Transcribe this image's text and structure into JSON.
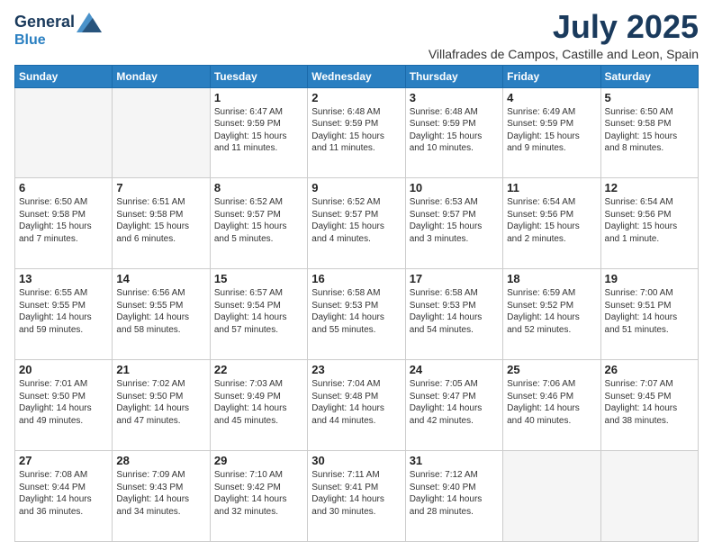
{
  "logo": {
    "line1": "General",
    "line2": "Blue"
  },
  "title": "July 2025",
  "location": "Villafrades de Campos, Castille and Leon, Spain",
  "weekdays": [
    "Sunday",
    "Monday",
    "Tuesday",
    "Wednesday",
    "Thursday",
    "Friday",
    "Saturday"
  ],
  "weeks": [
    [
      {
        "day": "",
        "info": ""
      },
      {
        "day": "",
        "info": ""
      },
      {
        "day": "1",
        "info": "Sunrise: 6:47 AM\nSunset: 9:59 PM\nDaylight: 15 hours and 11 minutes."
      },
      {
        "day": "2",
        "info": "Sunrise: 6:48 AM\nSunset: 9:59 PM\nDaylight: 15 hours and 11 minutes."
      },
      {
        "day": "3",
        "info": "Sunrise: 6:48 AM\nSunset: 9:59 PM\nDaylight: 15 hours and 10 minutes."
      },
      {
        "day": "4",
        "info": "Sunrise: 6:49 AM\nSunset: 9:59 PM\nDaylight: 15 hours and 9 minutes."
      },
      {
        "day": "5",
        "info": "Sunrise: 6:50 AM\nSunset: 9:58 PM\nDaylight: 15 hours and 8 minutes."
      }
    ],
    [
      {
        "day": "6",
        "info": "Sunrise: 6:50 AM\nSunset: 9:58 PM\nDaylight: 15 hours and 7 minutes."
      },
      {
        "day": "7",
        "info": "Sunrise: 6:51 AM\nSunset: 9:58 PM\nDaylight: 15 hours and 6 minutes."
      },
      {
        "day": "8",
        "info": "Sunrise: 6:52 AM\nSunset: 9:57 PM\nDaylight: 15 hours and 5 minutes."
      },
      {
        "day": "9",
        "info": "Sunrise: 6:52 AM\nSunset: 9:57 PM\nDaylight: 15 hours and 4 minutes."
      },
      {
        "day": "10",
        "info": "Sunrise: 6:53 AM\nSunset: 9:57 PM\nDaylight: 15 hours and 3 minutes."
      },
      {
        "day": "11",
        "info": "Sunrise: 6:54 AM\nSunset: 9:56 PM\nDaylight: 15 hours and 2 minutes."
      },
      {
        "day": "12",
        "info": "Sunrise: 6:54 AM\nSunset: 9:56 PM\nDaylight: 15 hours and 1 minute."
      }
    ],
    [
      {
        "day": "13",
        "info": "Sunrise: 6:55 AM\nSunset: 9:55 PM\nDaylight: 14 hours and 59 minutes."
      },
      {
        "day": "14",
        "info": "Sunrise: 6:56 AM\nSunset: 9:55 PM\nDaylight: 14 hours and 58 minutes."
      },
      {
        "day": "15",
        "info": "Sunrise: 6:57 AM\nSunset: 9:54 PM\nDaylight: 14 hours and 57 minutes."
      },
      {
        "day": "16",
        "info": "Sunrise: 6:58 AM\nSunset: 9:53 PM\nDaylight: 14 hours and 55 minutes."
      },
      {
        "day": "17",
        "info": "Sunrise: 6:58 AM\nSunset: 9:53 PM\nDaylight: 14 hours and 54 minutes."
      },
      {
        "day": "18",
        "info": "Sunrise: 6:59 AM\nSunset: 9:52 PM\nDaylight: 14 hours and 52 minutes."
      },
      {
        "day": "19",
        "info": "Sunrise: 7:00 AM\nSunset: 9:51 PM\nDaylight: 14 hours and 51 minutes."
      }
    ],
    [
      {
        "day": "20",
        "info": "Sunrise: 7:01 AM\nSunset: 9:50 PM\nDaylight: 14 hours and 49 minutes."
      },
      {
        "day": "21",
        "info": "Sunrise: 7:02 AM\nSunset: 9:50 PM\nDaylight: 14 hours and 47 minutes."
      },
      {
        "day": "22",
        "info": "Sunrise: 7:03 AM\nSunset: 9:49 PM\nDaylight: 14 hours and 45 minutes."
      },
      {
        "day": "23",
        "info": "Sunrise: 7:04 AM\nSunset: 9:48 PM\nDaylight: 14 hours and 44 minutes."
      },
      {
        "day": "24",
        "info": "Sunrise: 7:05 AM\nSunset: 9:47 PM\nDaylight: 14 hours and 42 minutes."
      },
      {
        "day": "25",
        "info": "Sunrise: 7:06 AM\nSunset: 9:46 PM\nDaylight: 14 hours and 40 minutes."
      },
      {
        "day": "26",
        "info": "Sunrise: 7:07 AM\nSunset: 9:45 PM\nDaylight: 14 hours and 38 minutes."
      }
    ],
    [
      {
        "day": "27",
        "info": "Sunrise: 7:08 AM\nSunset: 9:44 PM\nDaylight: 14 hours and 36 minutes."
      },
      {
        "day": "28",
        "info": "Sunrise: 7:09 AM\nSunset: 9:43 PM\nDaylight: 14 hours and 34 minutes."
      },
      {
        "day": "29",
        "info": "Sunrise: 7:10 AM\nSunset: 9:42 PM\nDaylight: 14 hours and 32 minutes."
      },
      {
        "day": "30",
        "info": "Sunrise: 7:11 AM\nSunset: 9:41 PM\nDaylight: 14 hours and 30 minutes."
      },
      {
        "day": "31",
        "info": "Sunrise: 7:12 AM\nSunset: 9:40 PM\nDaylight: 14 hours and 28 minutes."
      },
      {
        "day": "",
        "info": ""
      },
      {
        "day": "",
        "info": ""
      }
    ]
  ]
}
